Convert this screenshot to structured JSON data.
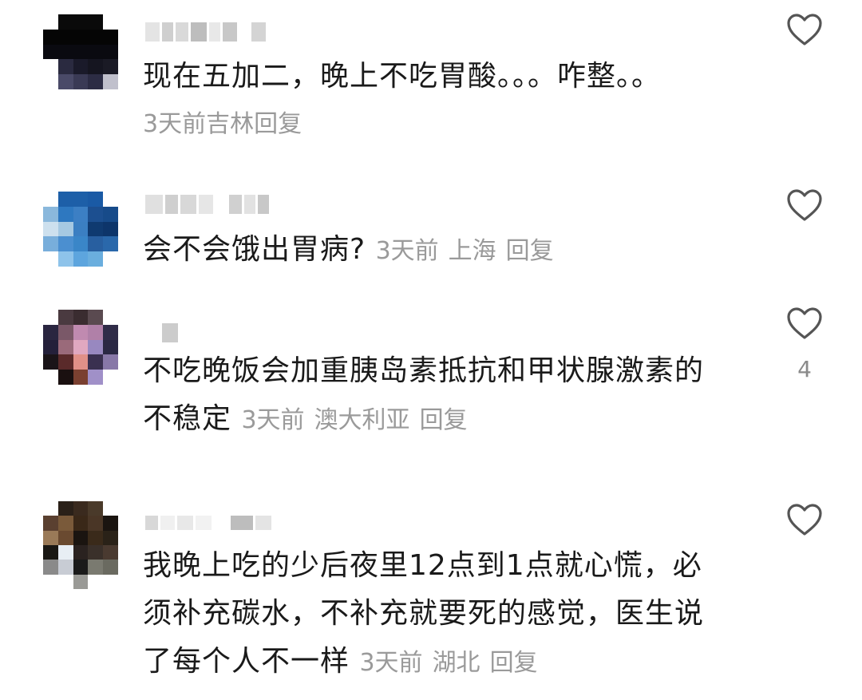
{
  "comments": [
    {
      "text": "现在五加二，晚上不吃胃酸。。。咋整。。",
      "time": "3天前",
      "location": "吉林",
      "reply": "回复",
      "like_icon": "heart-outline-icon"
    },
    {
      "text": "会不会饿出胃病?",
      "time": "3天前",
      "location": "上海",
      "reply": "回复",
      "like_icon": "heart-outline-icon"
    },
    {
      "text_line1": "不吃晚饭会加重胰岛素抵抗和甲状腺激素的",
      "text_line2": "不稳定",
      "time": "3天前",
      "location": "澳大利亚",
      "reply": "回复",
      "like_icon": "heart-outline-icon",
      "like_count": "4"
    },
    {
      "text_line1": "我晚上吃的少后夜里12点到1点就心慌，必",
      "text_line2": "须补充碳水，不补充就要死的感觉，医生说",
      "text_line3": "了每个人不一样",
      "time": "3天前",
      "location": "湖北",
      "reply": "回复",
      "like_icon": "heart-outline-icon"
    }
  ],
  "colors": {
    "text": "#1a1a1a",
    "meta": "#9a9a9a",
    "icon": "#555555"
  }
}
